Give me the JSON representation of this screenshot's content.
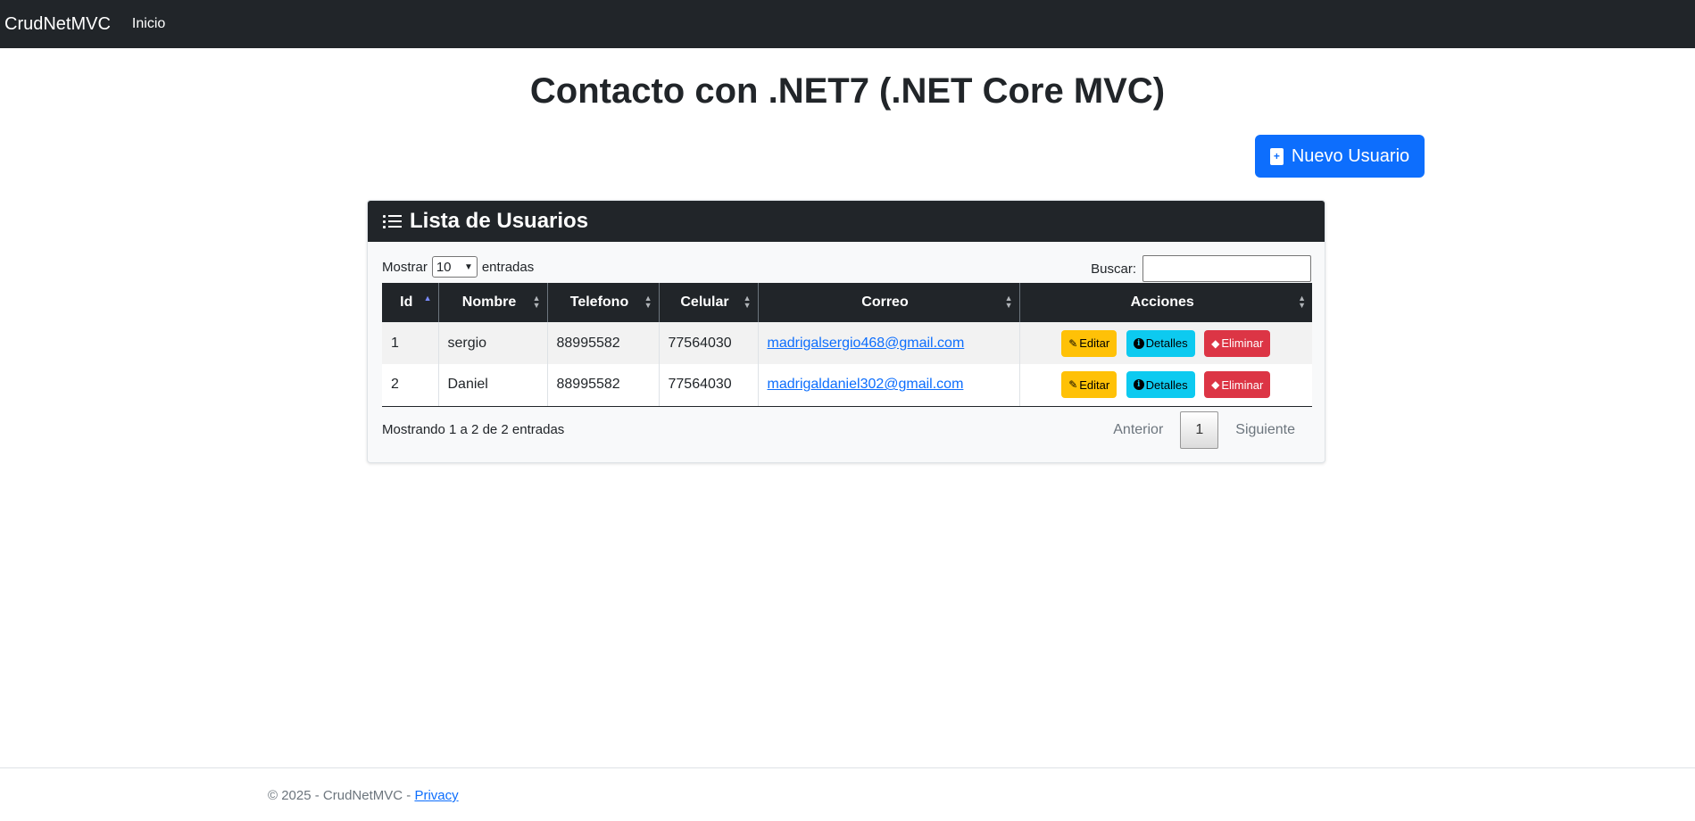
{
  "navbar": {
    "brand": "CrudNetMVC",
    "links": [
      "Inicio"
    ]
  },
  "page_title": "Contacto con .NET7 (.NET Core MVC)",
  "new_user_button": {
    "label": "Nuevo Usuario",
    "icon": "plus-square-icon",
    "color": "#0d6efd"
  },
  "card": {
    "title": "Lista de Usuarios",
    "icon": "list-icon",
    "length_menu": {
      "prefix": "Mostrar",
      "value": "10",
      "suffix": "entradas"
    },
    "search": {
      "label": "Buscar:",
      "value": ""
    },
    "columns": [
      "Id",
      "Nombre",
      "Telefono",
      "Celular",
      "Correo",
      "Acciones"
    ],
    "sorted_column": "Id",
    "rows": [
      {
        "id": "1",
        "nombre": "sergio",
        "telefono": "88995582",
        "celular": "77564030",
        "correo": "madrigalsergio468@gmail.com"
      },
      {
        "id": "2",
        "nombre": "Daniel",
        "telefono": "88995582",
        "celular": "77564030",
        "correo": "madrigaldaniel302@gmail.com"
      }
    ],
    "actions": {
      "edit": "Editar",
      "details": "Detalles",
      "delete": "Eliminar"
    },
    "info": "Mostrando 1 a 2 de 2 entradas",
    "pagination": {
      "previous": "Anterior",
      "current": "1",
      "next": "Siguiente"
    }
  },
  "footer": {
    "text": "© 2025 - CrudNetMVC - ",
    "link": "Privacy"
  },
  "colors": {
    "navbar": "#212529",
    "primary": "#0d6efd",
    "warning": "#ffc107",
    "info": "#0dcaf0",
    "danger": "#dc3545"
  }
}
